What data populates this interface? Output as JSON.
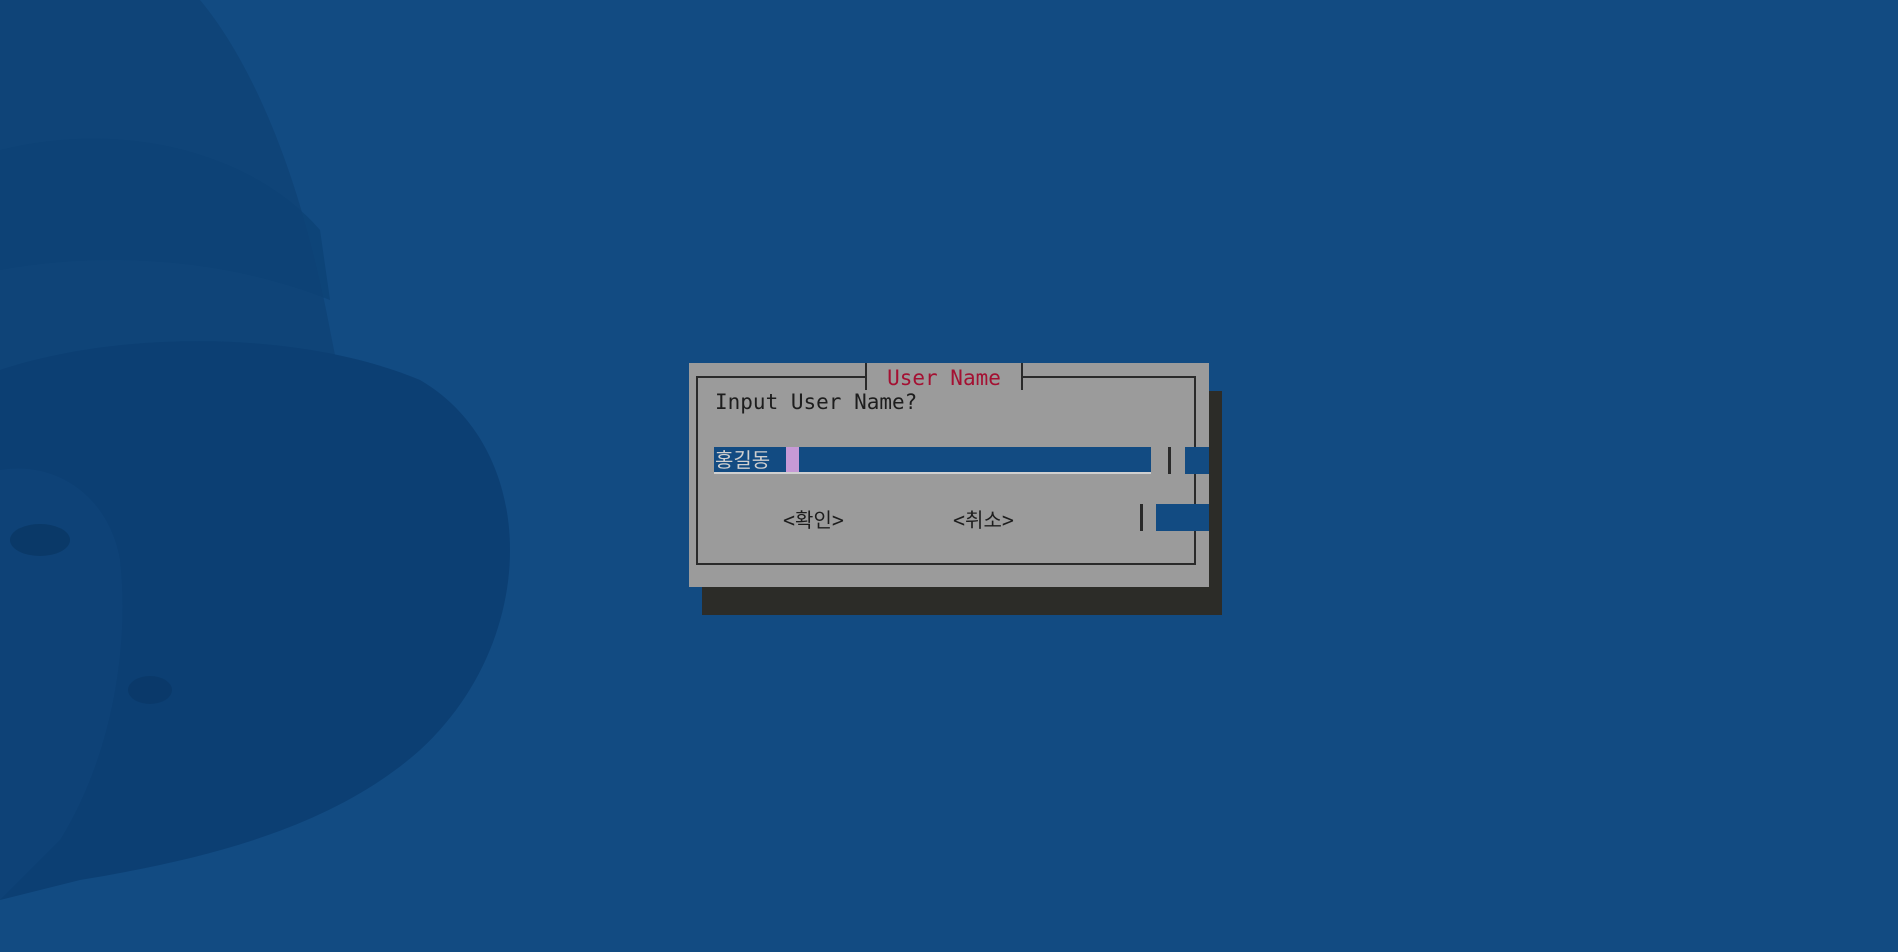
{
  "dialog": {
    "title": "User Name",
    "prompt": "Input User Name?",
    "input_value": "홍길동",
    "buttons": {
      "ok_label": "<확인>",
      "cancel_label": "<취소>"
    }
  },
  "colors": {
    "background": "#124b82",
    "dialog": "#9b9b9b",
    "title_text": "#a41032",
    "cursor": "#c79ad6",
    "shadow": "#2c2c28"
  }
}
